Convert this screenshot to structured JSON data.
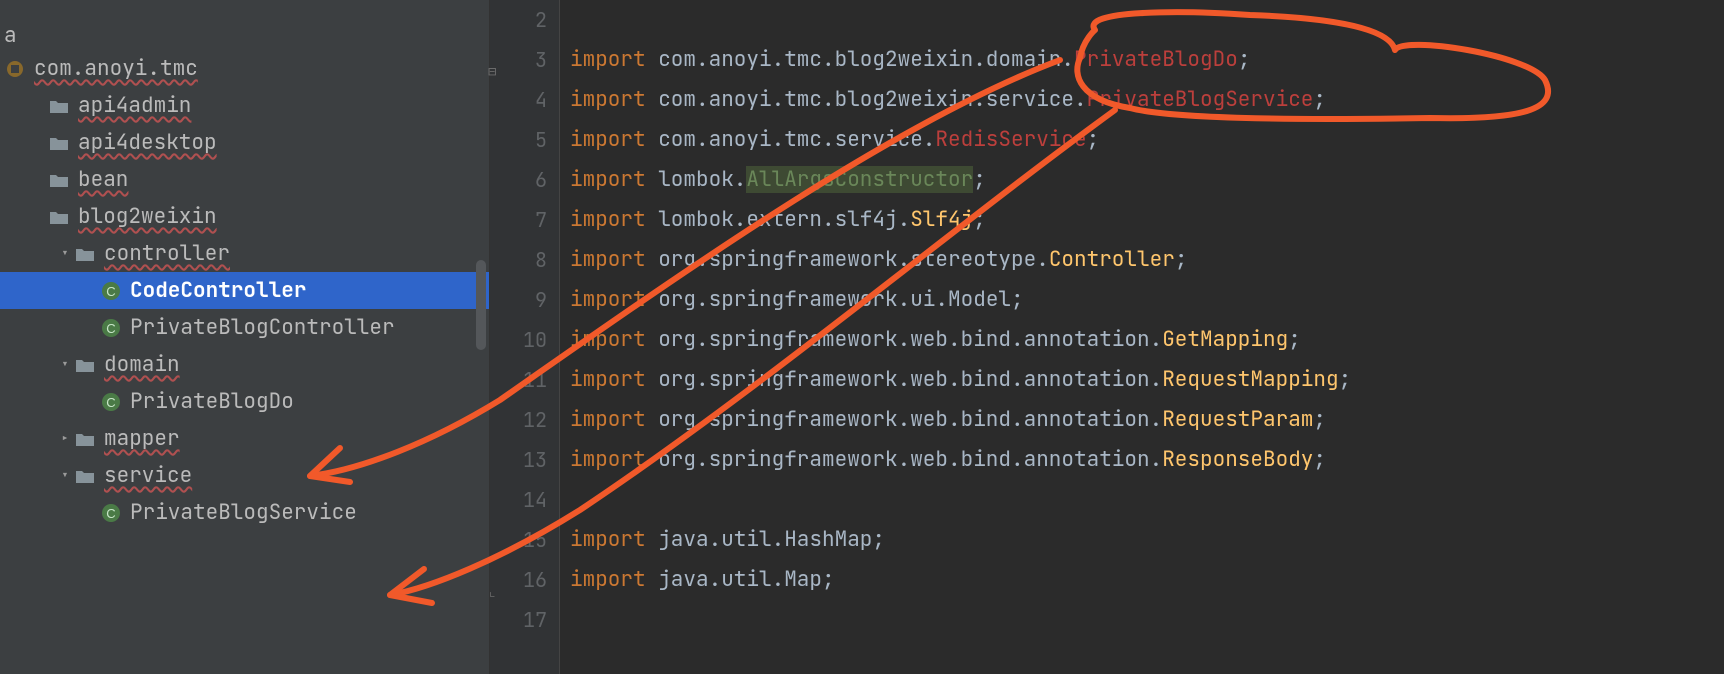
{
  "tree": {
    "root_partial": "a",
    "package": "com.anoyi.tmc",
    "items": [
      {
        "label": "api4admin",
        "depth": 1,
        "kind": "folder",
        "chev": ""
      },
      {
        "label": "api4desktop",
        "depth": 1,
        "kind": "folder",
        "chev": ""
      },
      {
        "label": "bean",
        "depth": 1,
        "kind": "folder",
        "chev": ""
      },
      {
        "label": "blog2weixin",
        "depth": 1,
        "kind": "folder",
        "chev": ""
      },
      {
        "label": "controller",
        "depth": 2,
        "kind": "folder",
        "chev": "v"
      },
      {
        "label": "CodeController",
        "depth": 3,
        "kind": "class",
        "chev": "",
        "selected": true
      },
      {
        "label": "PrivateBlogController",
        "depth": 3,
        "kind": "class",
        "chev": ""
      },
      {
        "label": "domain",
        "depth": 2,
        "kind": "folder",
        "chev": "v"
      },
      {
        "label": "PrivateBlogDo",
        "depth": 3,
        "kind": "class",
        "chev": ""
      },
      {
        "label": "mapper",
        "depth": 2,
        "kind": "folder",
        "chev": ">"
      },
      {
        "label": "service",
        "depth": 2,
        "kind": "folder",
        "chev": "v"
      },
      {
        "label": "PrivateBlogService",
        "depth": 3,
        "kind": "class",
        "chev": ""
      }
    ]
  },
  "code": [
    {
      "n": 2,
      "seg": []
    },
    {
      "n": 3,
      "seg": [
        [
          "kw",
          "import "
        ],
        [
          "pkg",
          "com.anoyi.tmc.blog2weixin.domain."
        ],
        [
          "err",
          "PrivateBlogDo"
        ],
        [
          "pkg",
          ";"
        ]
      ]
    },
    {
      "n": 4,
      "seg": [
        [
          "kw",
          "import "
        ],
        [
          "pkg",
          "com.anoyi.tmc.blog2weixin.service."
        ],
        [
          "err",
          "PrivateBlogService"
        ],
        [
          "pkg",
          ";"
        ]
      ]
    },
    {
      "n": 5,
      "seg": [
        [
          "kw",
          "import "
        ],
        [
          "pkg",
          "com.anoyi.tmc.service."
        ],
        [
          "err",
          "RedisService"
        ],
        [
          "pkg",
          ";"
        ]
      ]
    },
    {
      "n": 6,
      "seg": [
        [
          "kw",
          "import "
        ],
        [
          "pkg",
          "lombok."
        ],
        [
          "ann",
          "AllArgsConstructor"
        ],
        [
          "pkg",
          ";"
        ]
      ]
    },
    {
      "n": 7,
      "seg": [
        [
          "kw",
          "import "
        ],
        [
          "pkg",
          "lombok.extern.slf4j."
        ],
        [
          "clsY",
          "Slf4j"
        ],
        [
          "pkg",
          ";"
        ]
      ]
    },
    {
      "n": 8,
      "seg": [
        [
          "kw",
          "import "
        ],
        [
          "pkg",
          "org.springframework.stereotype."
        ],
        [
          "clsY",
          "Controller"
        ],
        [
          "pkg",
          ";"
        ]
      ]
    },
    {
      "n": 9,
      "seg": [
        [
          "kw",
          "import "
        ],
        [
          "pkg",
          "org.springframework.ui."
        ],
        [
          "cls",
          "Model"
        ],
        [
          "pkg",
          ";"
        ]
      ]
    },
    {
      "n": 10,
      "seg": [
        [
          "kw",
          "import "
        ],
        [
          "pkg",
          "org.springframework.web.bind.annotation."
        ],
        [
          "clsY",
          "GetMapping"
        ],
        [
          "pkg",
          ";"
        ]
      ]
    },
    {
      "n": 11,
      "seg": [
        [
          "kw",
          "import "
        ],
        [
          "pkg",
          "org.springframework.web.bind.annotation."
        ],
        [
          "clsY",
          "RequestMapping"
        ],
        [
          "pkg",
          ";"
        ]
      ]
    },
    {
      "n": 12,
      "seg": [
        [
          "kw",
          "import "
        ],
        [
          "pkg",
          "org.springframework.web.bind.annotation."
        ],
        [
          "clsY",
          "RequestParam"
        ],
        [
          "pkg",
          ";"
        ]
      ]
    },
    {
      "n": 13,
      "seg": [
        [
          "kw",
          "import "
        ],
        [
          "pkg",
          "org.springframework.web.bind.annotation."
        ],
        [
          "clsY",
          "ResponseBody"
        ],
        [
          "pkg",
          ";"
        ]
      ]
    },
    {
      "n": 14,
      "seg": []
    },
    {
      "n": 15,
      "seg": [
        [
          "kw",
          "import "
        ],
        [
          "pkg",
          "java.util.HashMap;"
        ]
      ]
    },
    {
      "n": 16,
      "seg": [
        [
          "kw",
          "import "
        ],
        [
          "pkg",
          "java.util.Map;"
        ]
      ]
    },
    {
      "n": 17,
      "seg": []
    }
  ]
}
